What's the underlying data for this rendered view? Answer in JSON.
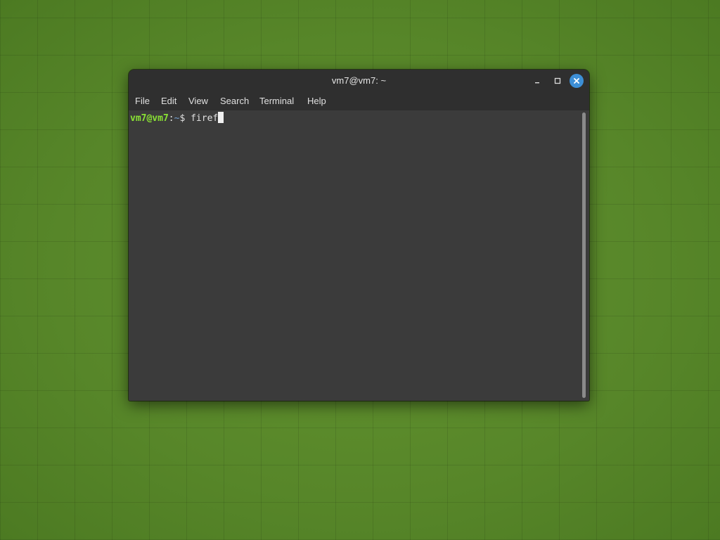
{
  "window": {
    "title": "vm7@vm7: ~"
  },
  "menubar": {
    "items": [
      {
        "label": "File"
      },
      {
        "label": "Edit"
      },
      {
        "label": "View"
      },
      {
        "label": "Search"
      },
      {
        "label": "Terminal"
      },
      {
        "label": "Help"
      }
    ]
  },
  "terminal": {
    "prompt_user": "vm7@vm7",
    "prompt_sep": ":",
    "prompt_path": "~",
    "prompt_symbol": "$ ",
    "input": "firef"
  },
  "icons": {
    "minimize": "minimize-icon",
    "maximize": "maximize-icon",
    "close": "close-icon"
  },
  "colors": {
    "desktop_background": "#5b8a2e",
    "terminal_background": "#3b3b3b",
    "titlebar": "#2f2f2f",
    "prompt_user": "#8ae234",
    "close_button": "#3d8fd6"
  }
}
